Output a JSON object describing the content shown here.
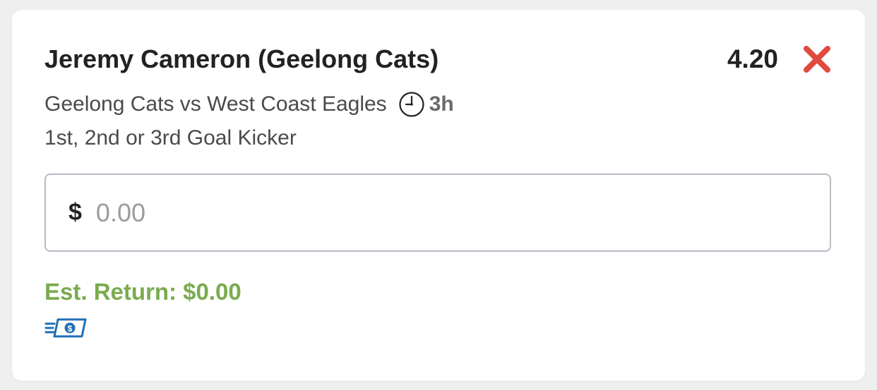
{
  "bet": {
    "selection": "Jeremy Cameron (Geelong Cats)",
    "odds": "4.20",
    "match": "Geelong Cats vs West Coast Eagles",
    "start_time": "3h",
    "market": "1st, 2nd or 3rd Goal Kicker"
  },
  "stake": {
    "currency": "$",
    "placeholder": "0.00",
    "value": ""
  },
  "est_return": "Est. Return: $0.00",
  "icons": {
    "remove": "close-icon",
    "clock": "clock-icon",
    "cash": "cash-icon"
  },
  "colors": {
    "remove": "#e04a3f",
    "est_return": "#7aab4e",
    "cash_icon": "#1f6fb5"
  }
}
